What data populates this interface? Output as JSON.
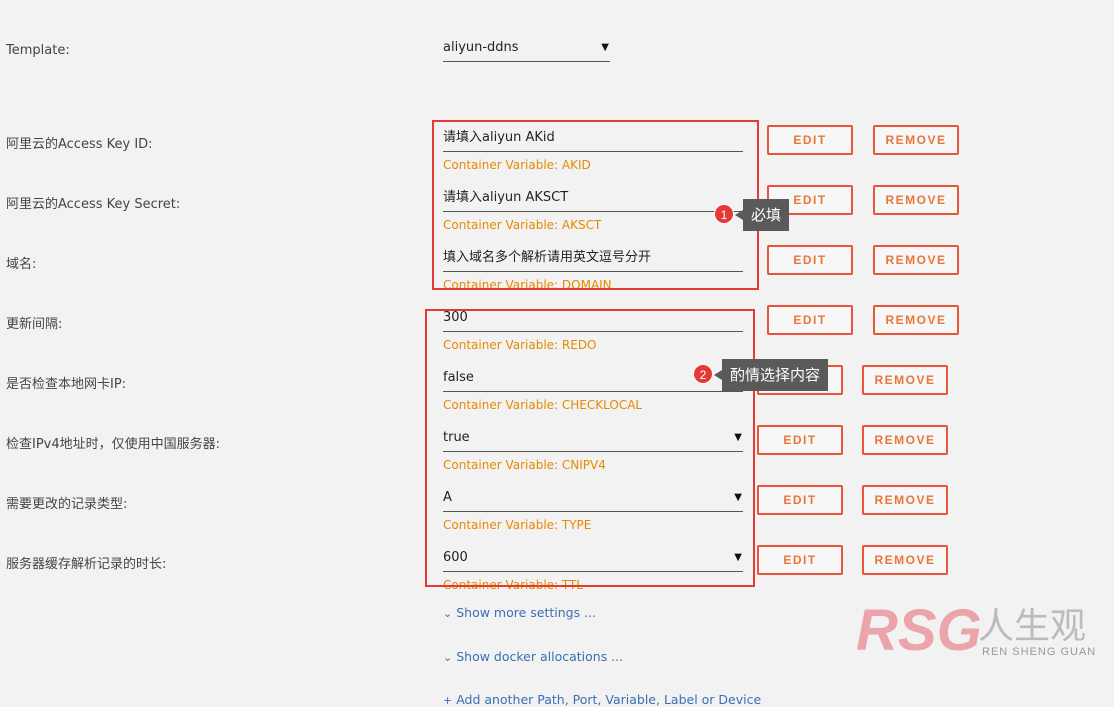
{
  "template": {
    "label": "Template:",
    "value": "aliyun-ddns"
  },
  "buttons": {
    "edit": "EDIT",
    "remove": "REMOVE"
  },
  "fields": [
    {
      "label": "阿里云的Access Key ID:",
      "value": "请填入aliyun AKid",
      "var": "Container Variable: AKID",
      "dropdown": false
    },
    {
      "label": "阿里云的Access Key Secret:",
      "value": "请填入aliyun AKSCT",
      "var": "Container Variable: AKSCT",
      "dropdown": false
    },
    {
      "label": "域名:",
      "value": "填入域名多个解析请用英文逗号分开",
      "var": "Container Variable: DOMAIN",
      "dropdown": false
    },
    {
      "label": "更新间隔:",
      "value": "300",
      "var": "Container Variable: REDO",
      "dropdown": false
    },
    {
      "label": "是否检查本地网卡IP:",
      "value": "false",
      "var": "Container Variable: CHECKLOCAL",
      "dropdown": false
    },
    {
      "label": "检查IPv4地址时，仅使用中国服务器:",
      "value": "true",
      "var": "Container Variable: CNIPV4",
      "dropdown": true
    },
    {
      "label": "需要更改的记录类型:",
      "value": "A",
      "var": "Container Variable: TYPE",
      "dropdown": true
    },
    {
      "label": "服务器缓存解析记录的时长:",
      "value": "600",
      "var": "Container Variable: TTL",
      "dropdown": true
    }
  ],
  "annotations": [
    {
      "num": "1",
      "text": "必填"
    },
    {
      "num": "2",
      "text": "酌情选择内容"
    }
  ],
  "links": {
    "more_settings": "Show more settings ...",
    "docker_alloc": "Show docker allocations ...",
    "add_another": "Add another Path, Port, Variable, Label or Device"
  },
  "watermark": {
    "logo": "RSG",
    "cn": "人生观",
    "en": "REN SHENG GUAN"
  },
  "colors": {
    "accent": "#e8553a",
    "var_text": "#e68a00",
    "link": "#3b6fb4",
    "callout": "#e53935"
  }
}
